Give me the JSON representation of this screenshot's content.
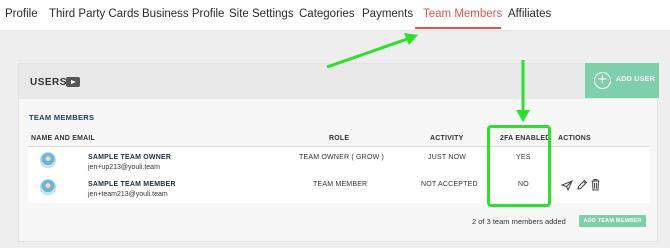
{
  "nav": {
    "tabs": [
      {
        "label": "Profile"
      },
      {
        "label": "Third Party Cards"
      },
      {
        "label": "Business Profile"
      },
      {
        "label": "Site Settings"
      },
      {
        "label": "Categories"
      },
      {
        "label": "Payments"
      },
      {
        "label": "Team Members"
      },
      {
        "label": "Affiliates"
      }
    ],
    "active_tab": "Team Members",
    "accent_color": "#e0544d"
  },
  "users_panel": {
    "title": "USERS",
    "video_icon": "youtube-play-icon",
    "add_user_label": "ADD USER"
  },
  "team_members": {
    "section_title": "TEAM MEMBERS",
    "columns": [
      "NAME AND EMAIL",
      "ROLE",
      "ACTIVITY",
      "2FA ENABLED",
      "ACTIONS"
    ],
    "rows": [
      {
        "name": "SAMPLE TEAM OWNER",
        "email": "jen+up213@youli.team",
        "role": "TEAM OWNER ( GROW )",
        "activity": "JUST NOW",
        "twofa": "YES",
        "actions": []
      },
      {
        "name": "SAMPLE TEAM MEMBER",
        "email": "jen+team213@youli.team",
        "role": "TEAM MEMBER",
        "activity": "NOT ACCEPTED",
        "twofa": "NO",
        "actions": [
          "send-icon",
          "pencil-icon",
          "trash-icon"
        ]
      }
    ],
    "footer_count": "2 of 3 team members added",
    "add_button_label": "ADD TEAM MEMBER"
  },
  "colors": {
    "button_green": "#7fcfaa",
    "annotation_green": "#2ee02e"
  }
}
